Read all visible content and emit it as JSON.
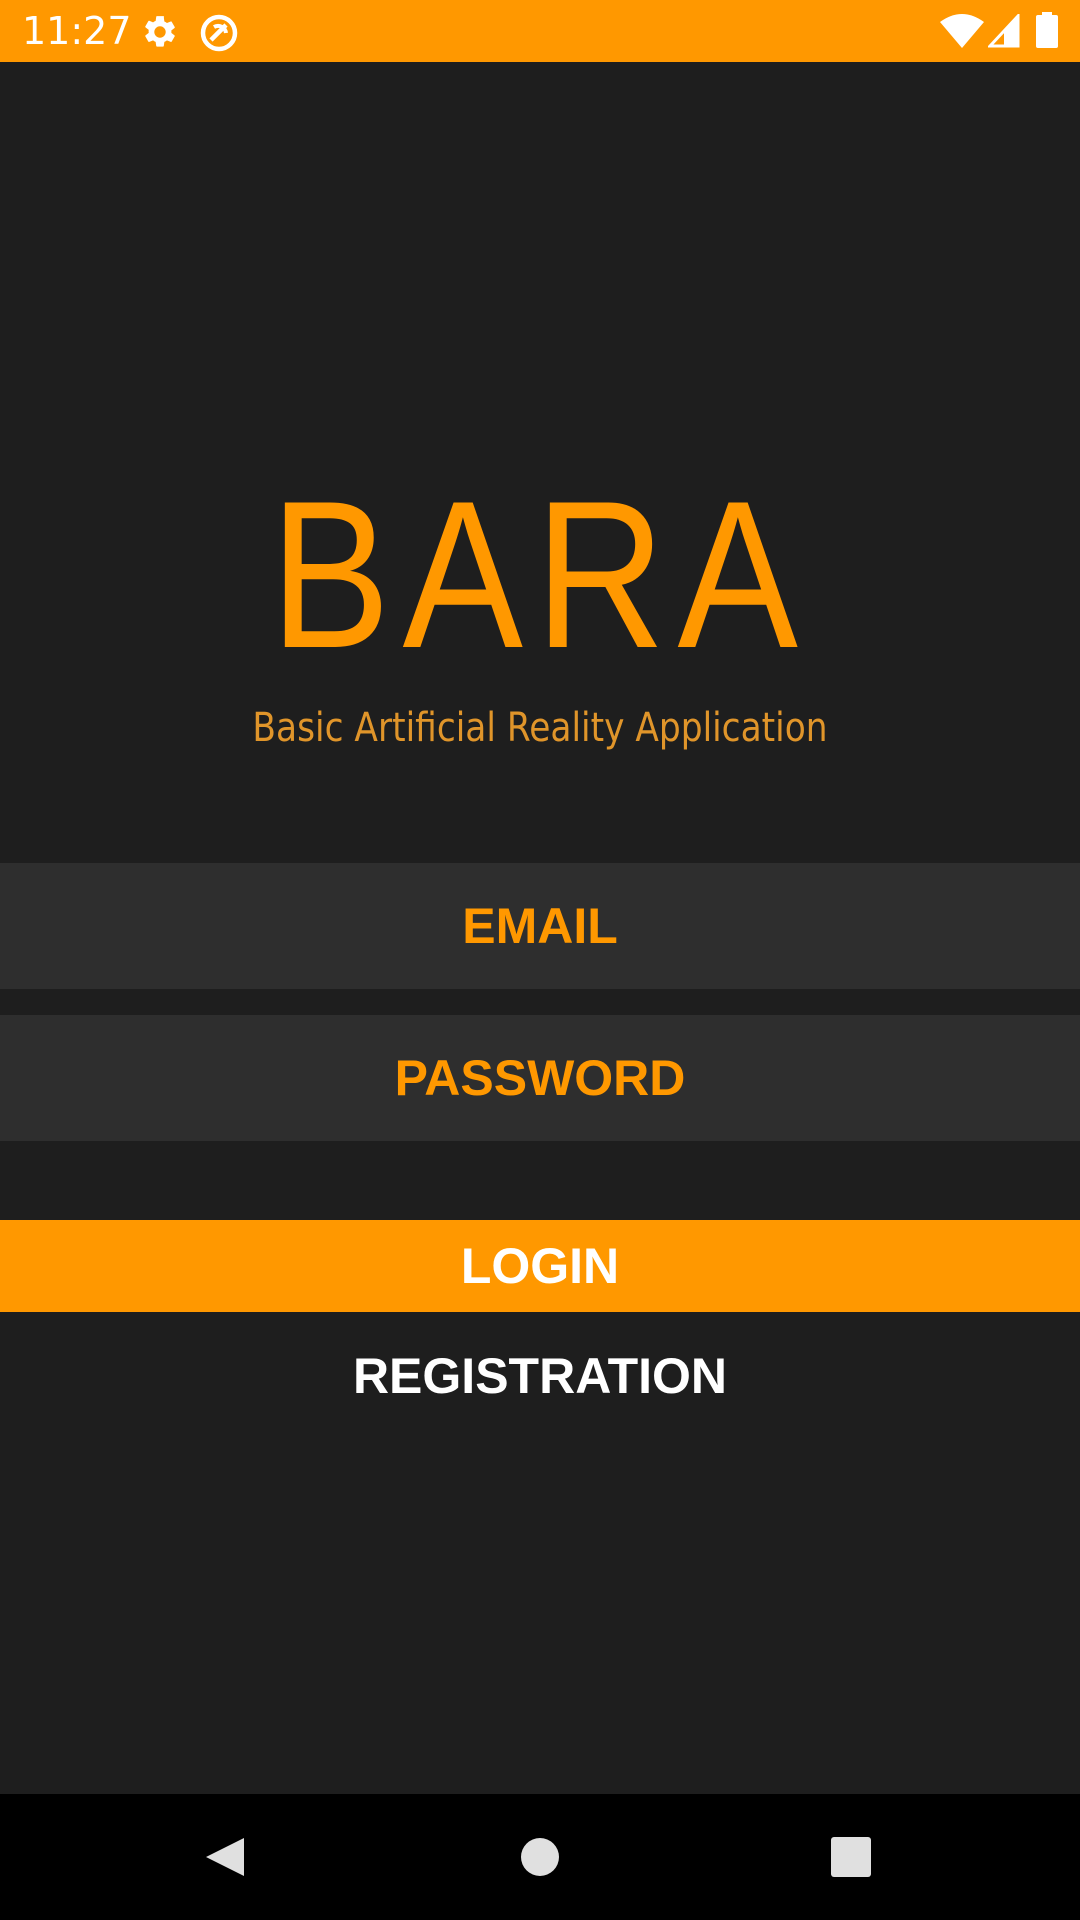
{
  "status_bar": {
    "time": "11:27",
    "icons": [
      "gear-icon",
      "sync-icon",
      "wifi-icon",
      "signal-icon",
      "battery-icon"
    ]
  },
  "app": {
    "title": "BARA",
    "subtitle": "Basic Artificial Reality Application"
  },
  "form": {
    "email_placeholder": "EMAIL",
    "password_placeholder": "PASSWORD",
    "login_label": "LOGIN",
    "registration_label": "REGISTRATION"
  },
  "nav_bar": {
    "buttons": [
      "back-icon",
      "home-icon",
      "recents-icon"
    ]
  },
  "colors": {
    "accent": "#ff9800",
    "background": "#1e1e1e",
    "input_background": "#2e2e2e",
    "nav_background": "#000000",
    "subtitle": "#e0952a"
  }
}
